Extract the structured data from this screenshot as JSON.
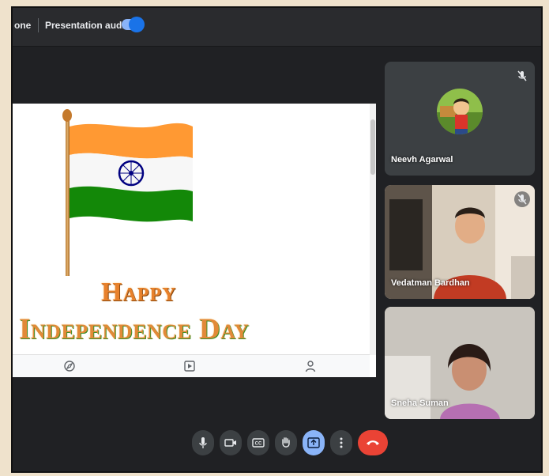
{
  "topbar": {
    "cut_text": "one",
    "presentation_audio_label": "Presentation audio",
    "toggle_state": "on"
  },
  "slide": {
    "line1": "Happy",
    "line2": "Independence Day"
  },
  "participants": [
    {
      "name": "Neevh Agarwal",
      "muted": true
    },
    {
      "name": "Vedatman Bardhan",
      "muted": true
    },
    {
      "name": "Sneha Suman",
      "muted": false
    }
  ],
  "controls": [
    "microphone-icon",
    "camera-icon",
    "captions-icon",
    "raise-hand-icon",
    "present-icon",
    "more-options-icon",
    "end-call-icon"
  ],
  "colors": {
    "saffron": "#ff9933",
    "green": "#138808",
    "navy": "#000080",
    "accent": "#8ab4f8",
    "end_call": "#ea4335"
  }
}
